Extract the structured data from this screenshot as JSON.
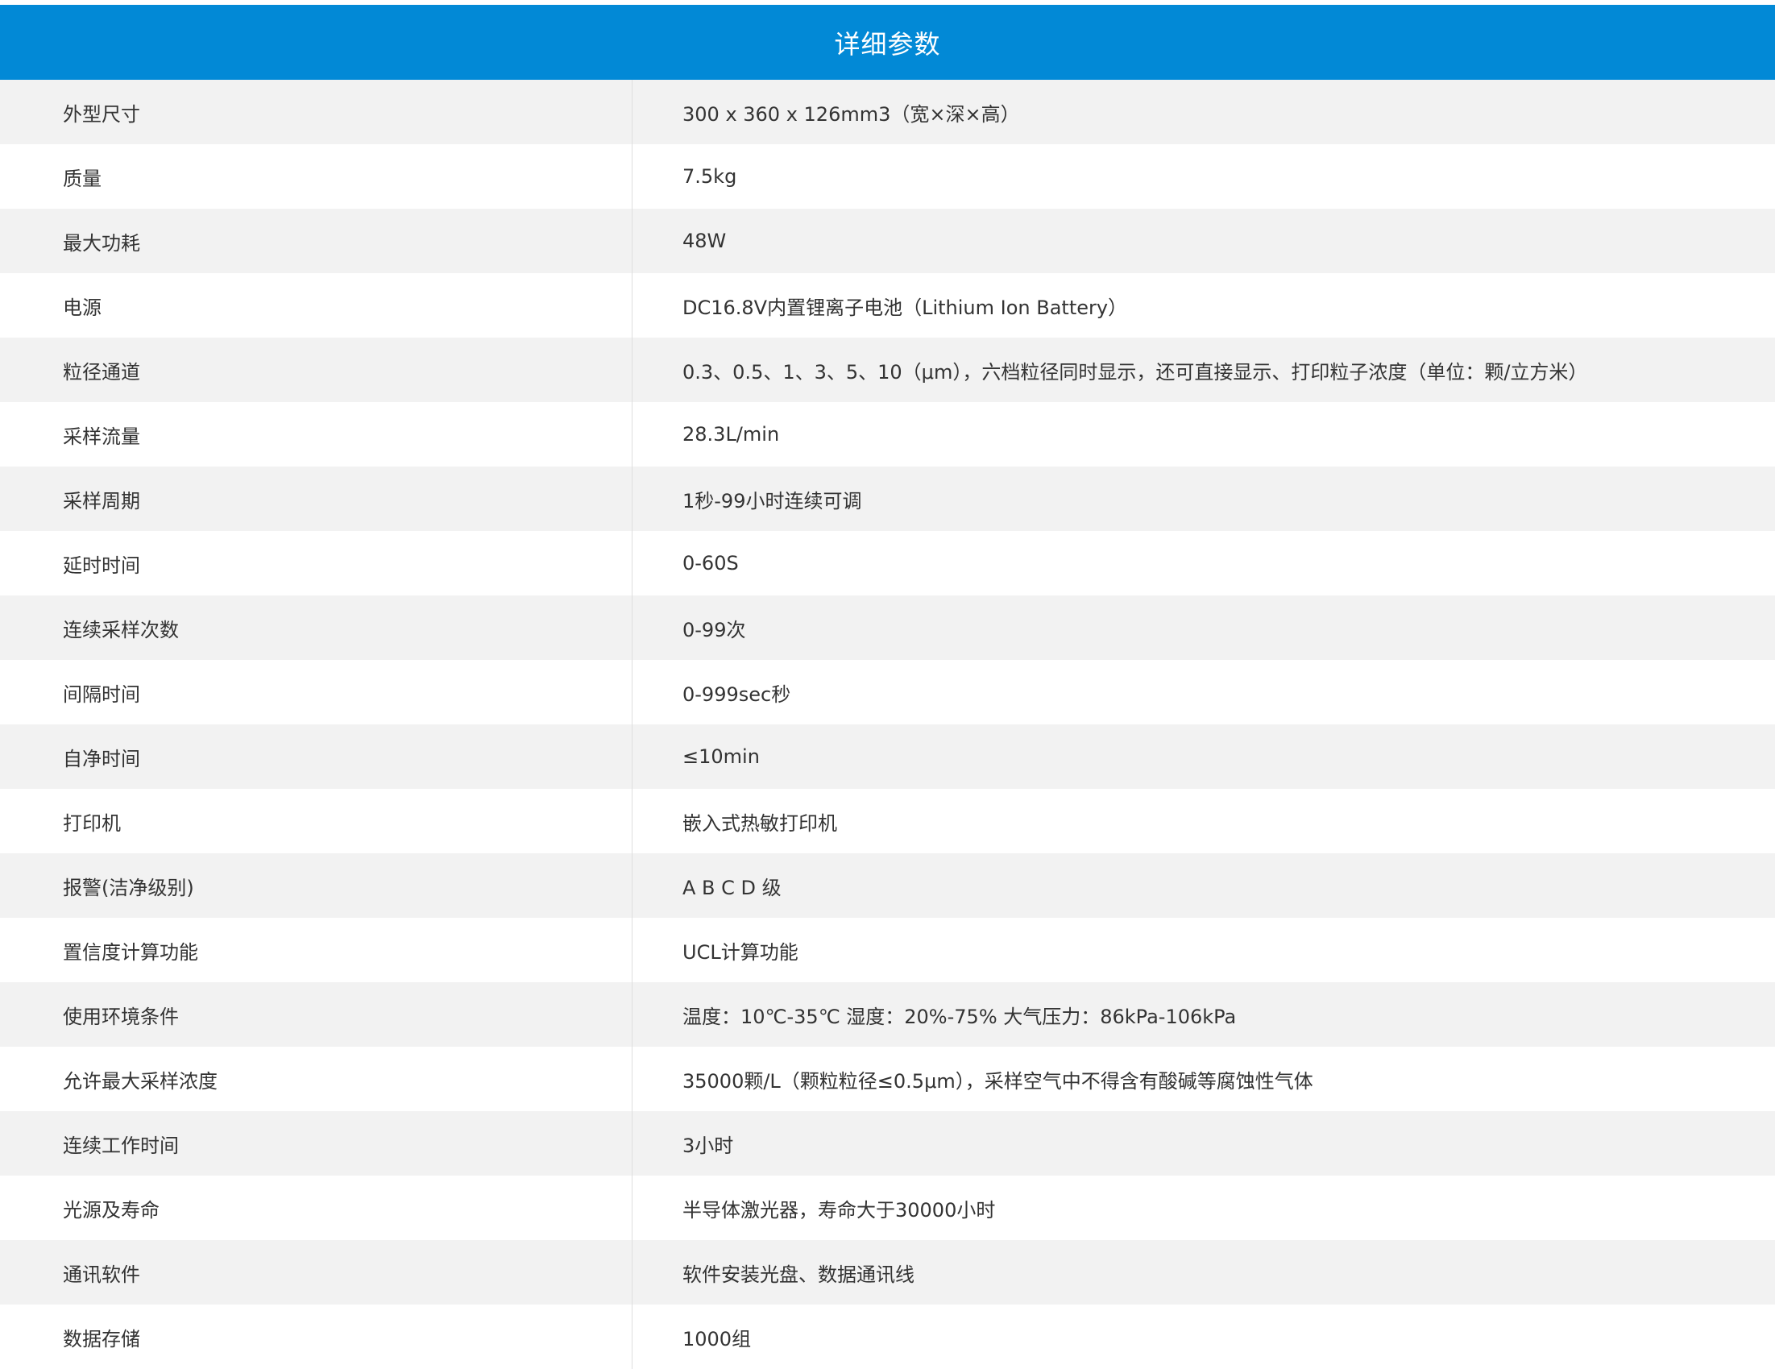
{
  "header": {
    "title": "详细参数"
  },
  "rows": [
    {
      "label": "外型尺寸",
      "value": "300 x 360 x 126mm3（宽×深×高）"
    },
    {
      "label": "质量",
      "value": "7.5kg"
    },
    {
      "label": "最大功耗",
      "value": "48W"
    },
    {
      "label": "电源",
      "value": "DC16.8V内置锂离子电池（Lithium Ion Battery）"
    },
    {
      "label": "粒径通道",
      "value": "0.3、0.5、1、3、5、10（μm），六档粒径同时显示，还可直接显示、打印粒子浓度（单位：颗/立方米）"
    },
    {
      "label": "采样流量",
      "value": "28.3L/min"
    },
    {
      "label": "采样周期",
      "value": "1秒-99小时连续可调"
    },
    {
      "label": "延时时间",
      "value": "0-60S"
    },
    {
      "label": "连续采样次数",
      "value": "0-99次"
    },
    {
      "label": "间隔时间",
      "value": "0-999sec秒"
    },
    {
      "label": "自净时间",
      "value": "≤10min"
    },
    {
      "label": "打印机",
      "value": "嵌入式热敏打印机"
    },
    {
      "label": "报警(洁净级别)",
      "value": "A B C D 级"
    },
    {
      "label": "置信度计算功能",
      "value": "UCL计算功能"
    },
    {
      "label": "使用环境条件",
      "value": "温度：10℃-35℃ 湿度：20%-75% 大气压力：86kPa-106kPa"
    },
    {
      "label": "允许最大采样浓度",
      "value": "35000颗/L（颗粒粒径≤0.5μm），采样空气中不得含有酸碱等腐蚀性气体"
    },
    {
      "label": "连续工作时间",
      "value": "3小时"
    },
    {
      "label": "光源及寿命",
      "value": "半导体激光器，寿命大于30000小时"
    },
    {
      "label": "通讯软件",
      "value": "软件安装光盘、数据通讯线"
    },
    {
      "label": "数据存储",
      "value": "1000组"
    }
  ],
  "colors": {
    "header_bg": "#0289d6",
    "row_alt_bg": "#f2f2f2",
    "text": "#333333"
  }
}
